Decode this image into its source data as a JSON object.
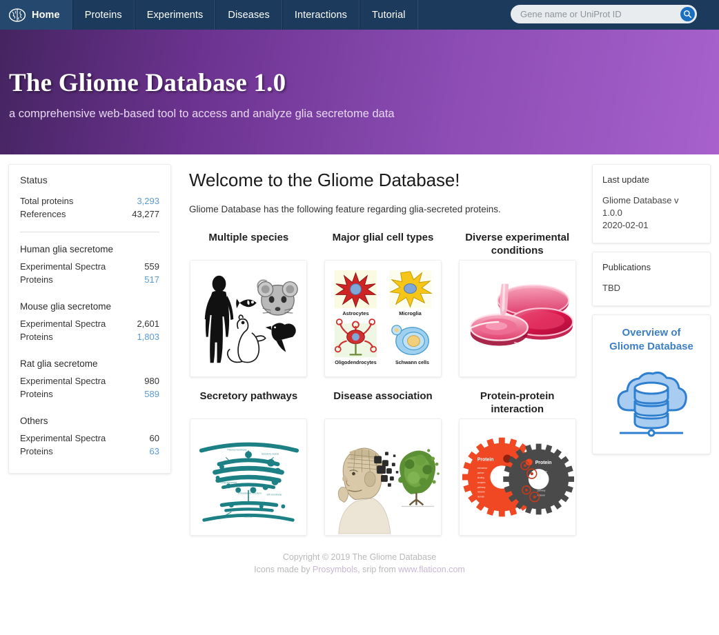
{
  "nav": {
    "logo_icon": "brain-icon",
    "items": [
      {
        "label": "Home",
        "active": true
      },
      {
        "label": "Proteins",
        "active": false
      },
      {
        "label": "Experiments",
        "active": false
      },
      {
        "label": "Diseases",
        "active": false
      },
      {
        "label": "Interactions",
        "active": false
      },
      {
        "label": "Tutorial",
        "active": false
      }
    ],
    "search": {
      "placeholder": "Gene name or UniProt ID",
      "value": "",
      "icon": "search-icon"
    },
    "bg_color": "#1b3a5c"
  },
  "hero": {
    "title": "The Gliome Database 1.0",
    "subtitle": "a comprehensive web-based tool to access and analyze glia secretome data",
    "gradient_from": "#452461",
    "gradient_to": "#a861cd"
  },
  "status": {
    "title": "Status",
    "totals": [
      {
        "label": "Total proteins",
        "value": "3,293",
        "is_link": true
      },
      {
        "label": "References",
        "value": "43,277",
        "is_link": false
      }
    ],
    "groups": [
      {
        "heading": "Human glia secretome",
        "rows": [
          {
            "label": "Experimental Spectra",
            "value": "559",
            "is_link": false
          },
          {
            "label": "Proteins",
            "value": "517",
            "is_link": true
          }
        ]
      },
      {
        "heading": "Mouse glia secretome",
        "rows": [
          {
            "label": "Experimental Spectra",
            "value": "2,601",
            "is_link": false
          },
          {
            "label": "Proteins",
            "value": "1,803",
            "is_link": true
          }
        ]
      },
      {
        "heading": "Rat glia secretome",
        "rows": [
          {
            "label": "Experimental Spectra",
            "value": "980",
            "is_link": false
          },
          {
            "label": "Proteins",
            "value": "589",
            "is_link": true
          }
        ]
      },
      {
        "heading": "Others",
        "rows": [
          {
            "label": "Experimental Spectra",
            "value": "60",
            "is_link": false
          },
          {
            "label": "Proteins",
            "value": "63",
            "is_link": true
          }
        ]
      }
    ],
    "link_color": "#5a9bd4"
  },
  "main": {
    "welcome_title": "Welcome to the Gliome Database!",
    "welcome_sub": "Gliome Database has the following feature regarding glia-secreted proteins.",
    "features": [
      {
        "title": "Multiple species",
        "image": "species-silhouettes-image"
      },
      {
        "title": "Major glial cell types",
        "image": "glial-cell-types-image"
      },
      {
        "title": "Diverse experimental conditions",
        "image": "cell-culture-dishes-image"
      },
      {
        "title": "Secretory pathways",
        "image": "golgi-secretory-pathway-image"
      },
      {
        "title": "Disease association",
        "image": "disease-association-image"
      },
      {
        "title": "Protein-protein interaction",
        "image": "interlocking-gears-image"
      }
    ],
    "cell_labels": [
      "Astrocytes",
      "Microglia",
      "Oligodendrocytes",
      "Schwann cells"
    ],
    "gear_labels": [
      "Protein",
      "Protein"
    ]
  },
  "right": {
    "last_update": {
      "heading": "Last update",
      "line1": "Gliome Database v 1.0.0",
      "line2": "2020-02-01"
    },
    "publications": {
      "heading": "Publications",
      "text": "TBD"
    },
    "overview": {
      "title_line1": "Overview of",
      "title_line2": "Gliome Database",
      "icon": "cloud-database-icon",
      "title_color": "#3c7fc4"
    }
  },
  "footer": {
    "copyright": "Copyright © 2019 The Gliome Database",
    "credits_prefix": "Icons made by ",
    "credit_author1": "Prosymbols",
    "credits_mid": ", srip from ",
    "credit_site": "www.flaticon.com"
  }
}
